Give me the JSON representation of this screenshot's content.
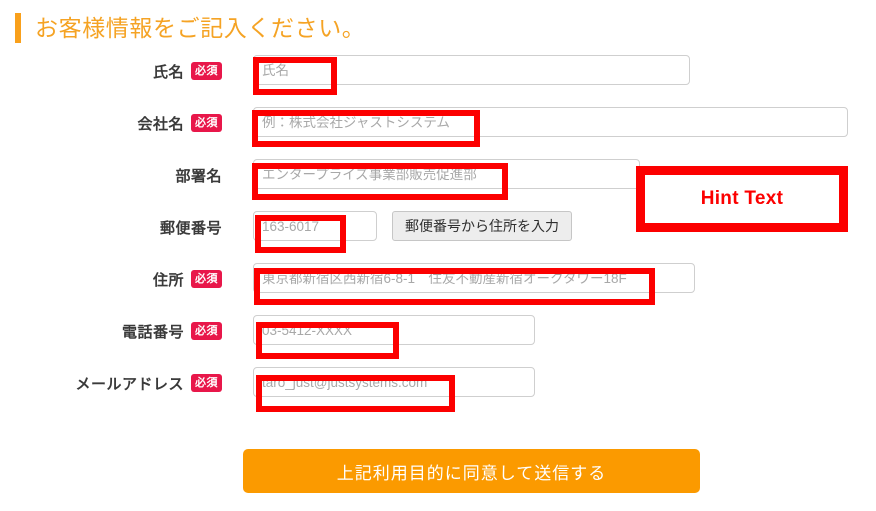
{
  "heading": {
    "text": "お客様情報をご記入ください。",
    "accent_color": "#f5a324"
  },
  "badges": {
    "required_label": "必須",
    "required_color": "#e8174a"
  },
  "form": {
    "rows": [
      {
        "label": "氏名",
        "required": true,
        "required_label": "必須",
        "placeholder": "氏名",
        "value": ""
      },
      {
        "label": "会社名",
        "required": true,
        "required_label": "必須",
        "placeholder": "例：株式会社ジャストシステム",
        "value": ""
      },
      {
        "label": "部署名",
        "required": false,
        "required_label": "",
        "placeholder": "エンタープライズ事業部販売促進部",
        "value": ""
      },
      {
        "label": "郵便番号",
        "required": false,
        "required_label": "",
        "placeholder": "163-6017",
        "value": "",
        "button_label": "郵便番号から住所を入力"
      },
      {
        "label": "住所",
        "required": true,
        "required_label": "必須",
        "placeholder": "東京都新宿区西新宿6-8-1　住友不動産新宿オークタワー18F",
        "value": ""
      },
      {
        "label": "電話番号",
        "required": true,
        "required_label": "必須",
        "placeholder": "03-5412-XXXX",
        "value": ""
      },
      {
        "label": "メールアドレス",
        "required": true,
        "required_label": "必須",
        "placeholder": "taro_just@justsystems.com",
        "value": ""
      }
    ]
  },
  "annotation": {
    "callout_label": "Hint Text",
    "callout_color": "#fc0000"
  },
  "submit": {
    "label": "上記利用目的に同意して送信する",
    "color": "#fb9a00"
  }
}
